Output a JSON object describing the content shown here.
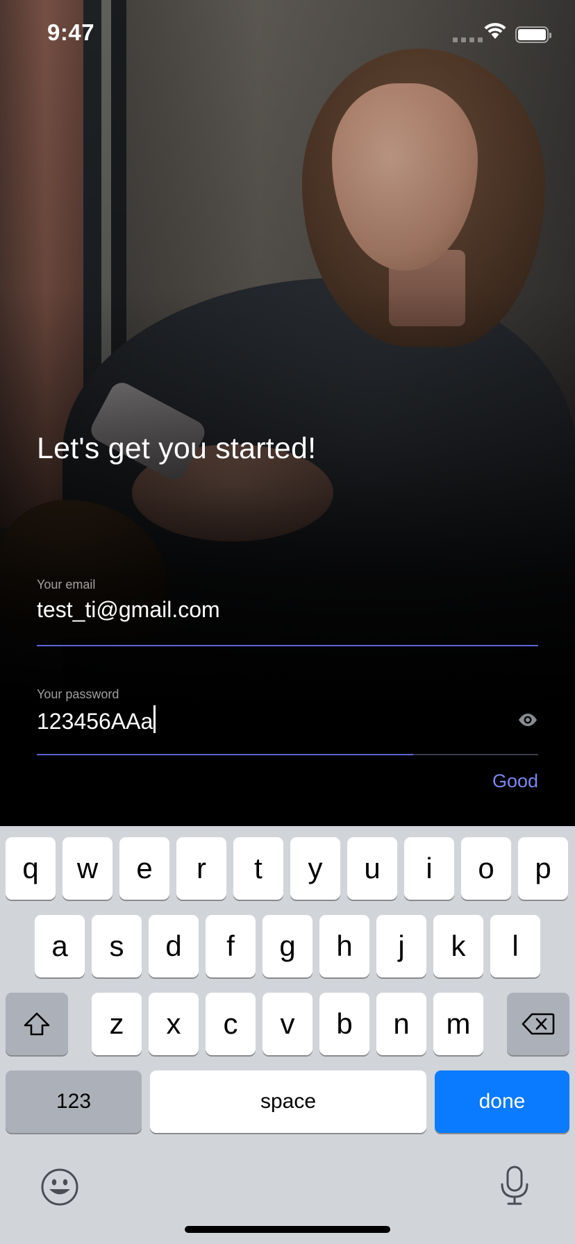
{
  "status_bar": {
    "time": "9:47"
  },
  "signup": {
    "headline": "Let's get you started!",
    "email": {
      "label": "Your email",
      "value": "test_ti@gmail.com"
    },
    "password": {
      "label": "Your password",
      "value": "123456AAa",
      "strength_label": "Good",
      "strength_fraction": 0.75
    },
    "accent_color": "#7c86f2"
  },
  "keyboard": {
    "row1": [
      "q",
      "w",
      "e",
      "r",
      "t",
      "y",
      "u",
      "i",
      "o",
      "p"
    ],
    "row2": [
      "a",
      "s",
      "d",
      "f",
      "g",
      "h",
      "j",
      "k",
      "l"
    ],
    "row3": [
      "z",
      "x",
      "c",
      "v",
      "b",
      "n",
      "m"
    ],
    "numbers_label": "123",
    "space_label": "space",
    "done_label": "done",
    "done_color": "#0a7aff",
    "icons": {
      "shift": "shift-icon",
      "delete": "delete-icon",
      "emoji": "emoji-icon",
      "mic": "mic-icon"
    }
  }
}
